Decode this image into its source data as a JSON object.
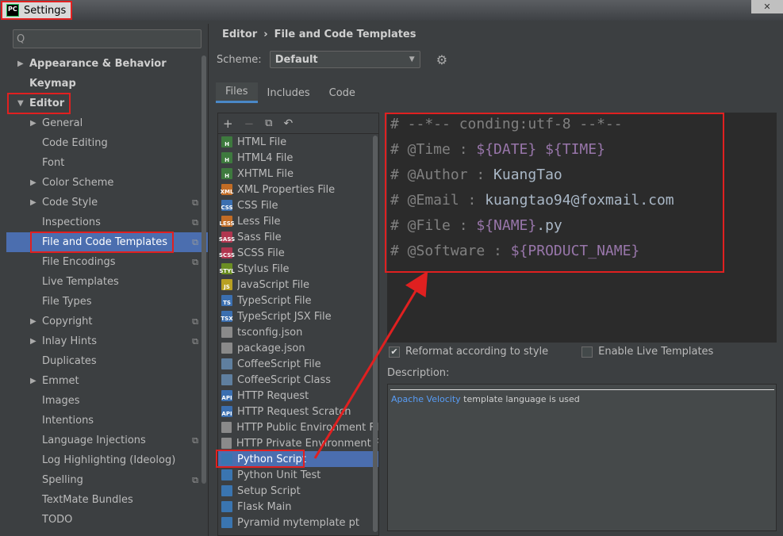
{
  "window": {
    "title": "Settings",
    "app_icon": "PC",
    "close_label": "✕"
  },
  "sidebar": {
    "search_placeholder": "Q",
    "items": [
      {
        "label": "Appearance & Behavior",
        "level": 0,
        "arrow": "▶",
        "bold": true
      },
      {
        "label": "Keymap",
        "level": 0,
        "arrow": "",
        "bold": true
      },
      {
        "label": "Editor",
        "level": 0,
        "arrow": "▼",
        "bold": true
      },
      {
        "label": "General",
        "level": 1,
        "arrow": "▶"
      },
      {
        "label": "Code Editing",
        "level": 1,
        "arrow": ""
      },
      {
        "label": "Font",
        "level": 1,
        "arrow": ""
      },
      {
        "label": "Color Scheme",
        "level": 1,
        "arrow": "▶"
      },
      {
        "label": "Code Style",
        "level": 1,
        "arrow": "▶",
        "proj": true
      },
      {
        "label": "Inspections",
        "level": 1,
        "arrow": "",
        "proj": true
      },
      {
        "label": "File and Code Templates",
        "level": 1,
        "arrow": "",
        "proj": true,
        "selected": true
      },
      {
        "label": "File Encodings",
        "level": 1,
        "arrow": "",
        "proj": true
      },
      {
        "label": "Live Templates",
        "level": 1,
        "arrow": ""
      },
      {
        "label": "File Types",
        "level": 1,
        "arrow": ""
      },
      {
        "label": "Copyright",
        "level": 1,
        "arrow": "▶",
        "proj": true
      },
      {
        "label": "Inlay Hints",
        "level": 1,
        "arrow": "▶",
        "proj": true
      },
      {
        "label": "Duplicates",
        "level": 1,
        "arrow": ""
      },
      {
        "label": "Emmet",
        "level": 1,
        "arrow": "▶"
      },
      {
        "label": "Images",
        "level": 1,
        "arrow": ""
      },
      {
        "label": "Intentions",
        "level": 1,
        "arrow": ""
      },
      {
        "label": "Language Injections",
        "level": 1,
        "arrow": "",
        "proj": true
      },
      {
        "label": "Log Highlighting (Ideolog)",
        "level": 1,
        "arrow": ""
      },
      {
        "label": "Spelling",
        "level": 1,
        "arrow": "",
        "proj": true
      },
      {
        "label": "TextMate Bundles",
        "level": 1,
        "arrow": ""
      },
      {
        "label": "TODO",
        "level": 1,
        "arrow": ""
      }
    ]
  },
  "breadcrumb": {
    "parent": "Editor",
    "separator": "›",
    "current": "File and Code Templates"
  },
  "scheme": {
    "label": "Scheme:",
    "value": "Default"
  },
  "tabs": [
    {
      "label": "Files",
      "active": true
    },
    {
      "label": "Includes",
      "active": false
    },
    {
      "label": "Code",
      "active": false
    }
  ],
  "templates": [
    {
      "name": "HTML File",
      "color": "#3e7a3e",
      "tag": "H"
    },
    {
      "name": "HTML4 File",
      "color": "#3e7a3e",
      "tag": "H"
    },
    {
      "name": "XHTML File",
      "color": "#3e7a3e",
      "tag": "H"
    },
    {
      "name": "XML Properties File",
      "color": "#c26c25",
      "tag": "XML"
    },
    {
      "name": "CSS File",
      "color": "#3b6fb0",
      "tag": "CSS"
    },
    {
      "name": "Less File",
      "color": "#c26c25",
      "tag": "LESS"
    },
    {
      "name": "Sass File",
      "color": "#b0364f",
      "tag": "SASS"
    },
    {
      "name": "SCSS File",
      "color": "#b0364f",
      "tag": "SCSS"
    },
    {
      "name": "Stylus File",
      "color": "#6b8e23",
      "tag": "STYL"
    },
    {
      "name": "JavaScript File",
      "color": "#b8a022",
      "tag": "JS"
    },
    {
      "name": "TypeScript File",
      "color": "#3b6fb0",
      "tag": "TS"
    },
    {
      "name": "TypeScript JSX File",
      "color": "#3b6fb0",
      "tag": "TSX"
    },
    {
      "name": "tsconfig.json",
      "color": "#8a8a8a",
      "tag": ""
    },
    {
      "name": "package.json",
      "color": "#8a8a8a",
      "tag": ""
    },
    {
      "name": "CoffeeScript File",
      "color": "#5f7f9f",
      "tag": ""
    },
    {
      "name": "CoffeeScript Class",
      "color": "#5f7f9f",
      "tag": ""
    },
    {
      "name": "HTTP Request",
      "color": "#3b6fb0",
      "tag": "API"
    },
    {
      "name": "HTTP Request Scratch",
      "color": "#3b6fb0",
      "tag": "API"
    },
    {
      "name": "HTTP Public Environment File",
      "color": "#8a8a8a",
      "tag": ""
    },
    {
      "name": "HTTP Private Environment File",
      "color": "#8a8a8a",
      "tag": ""
    },
    {
      "name": "Python Script",
      "color": "#3a75b0",
      "tag": "",
      "selected": true
    },
    {
      "name": "Python Unit Test",
      "color": "#3a75b0",
      "tag": ""
    },
    {
      "name": "Setup Script",
      "color": "#3a75b0",
      "tag": ""
    },
    {
      "name": "Flask Main",
      "color": "#3a75b0",
      "tag": ""
    },
    {
      "name": "Pyramid mytemplate pt",
      "color": "#3a75b0",
      "tag": ""
    }
  ],
  "editor": {
    "lines": [
      {
        "pre": "# --*-- conding:utf-8 --*--",
        "vars": []
      },
      {
        "pre": "# @Time : ",
        "var1": "${DATE}",
        "mid": " ",
        "var2": "${TIME}",
        "post": ""
      },
      {
        "pre": "# @Author : ",
        "txt": "KuangTao"
      },
      {
        "pre": "# @Email : ",
        "txt": "kuangtao94@foxmail.com"
      },
      {
        "pre": "# @File : ",
        "var1": "${NAME}",
        "post": ".py"
      },
      {
        "pre": "# @Software : ",
        "var1": "${PRODUCT_NAME}",
        "post": ""
      }
    ]
  },
  "options": {
    "reformat": {
      "label": "Reformat according to style",
      "checked": true
    },
    "live_templates": {
      "label": "Enable Live Templates",
      "checked": false
    }
  },
  "description": {
    "label": "Description:",
    "link": "Apache Velocity",
    "text": " template language is used"
  },
  "colors": {
    "accent": "#4b6eaf",
    "annotation": "#e02020",
    "background": "#3c3f41"
  }
}
